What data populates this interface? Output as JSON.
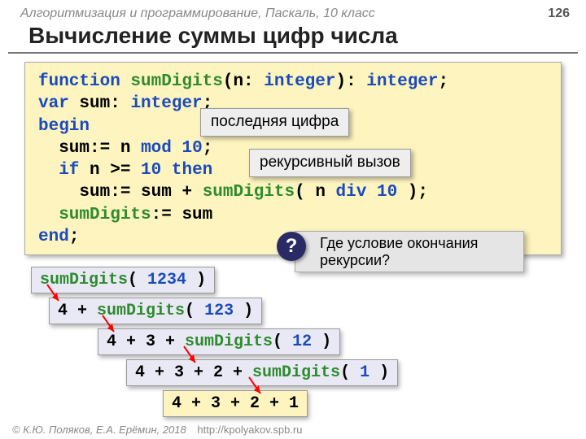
{
  "header": {
    "course": "Алгоритмизация и программирование, Паскаль, 10 класс",
    "page": "126"
  },
  "title": "Вычисление суммы цифр числа",
  "code": {
    "l1a": "function ",
    "l1b": "sumDigits",
    "l1c": "(n: ",
    "l1d": "integer",
    "l1e": "): ",
    "l1f": "integer",
    "l1g": ";",
    "l2a": "var",
    "l2b": " sum: ",
    "l2c": "integer",
    "l2d": ";",
    "l3a": "begin",
    "l4a": "  sum:",
    "l4b": "= ",
    "l4c": "n ",
    "l4d": "mod",
    "l4e": " 10",
    "l4f": ";",
    "l5a": "  if",
    "l5b": " n ",
    "l5c": ">= ",
    "l5d": "10",
    "l5e": " then",
    "l6a": "    sum:",
    "l6b": "= ",
    "l6c": "sum ",
    "l6d": "+ ",
    "l6e": "sumDigits",
    "l6f": "( ",
    "l6g": "n ",
    "l6h": "div",
    "l6i": " 10",
    "l6j": " );",
    "l7a": "  sumDigits",
    "l7b": ":",
    "l7c": "= ",
    "l7d": "sum",
    "l8a": "end",
    "l8b": ";"
  },
  "callouts": {
    "last": "последняя цифра",
    "recursive": "рекурсивный вызов"
  },
  "question": {
    "mark": "?",
    "text": "Где условие окончания рекурсии?"
  },
  "steps": {
    "s1a": "sumDigits",
    "s1b": "( ",
    "s1c": "1234",
    "s1d": " )",
    "s2a": "4 + ",
    "s2b": "sumDigits",
    "s2c": "( ",
    "s2d": "123",
    "s2e": " )",
    "s3a": "4 + 3 + ",
    "s3b": "sumDigits",
    "s3c": "( ",
    "s3d": "12",
    "s3e": " )",
    "s4a": "4 + 3 + 2 + ",
    "s4b": "sumDigits",
    "s4c": "( ",
    "s4d": "1",
    "s4e": " )",
    "s5": "4 + 3 + 2 + 1"
  },
  "footer": {
    "copy": "© К.Ю. Поляков, Е.А. Ерёмин, 2018",
    "url": "http://kpolyakov.spb.ru"
  }
}
